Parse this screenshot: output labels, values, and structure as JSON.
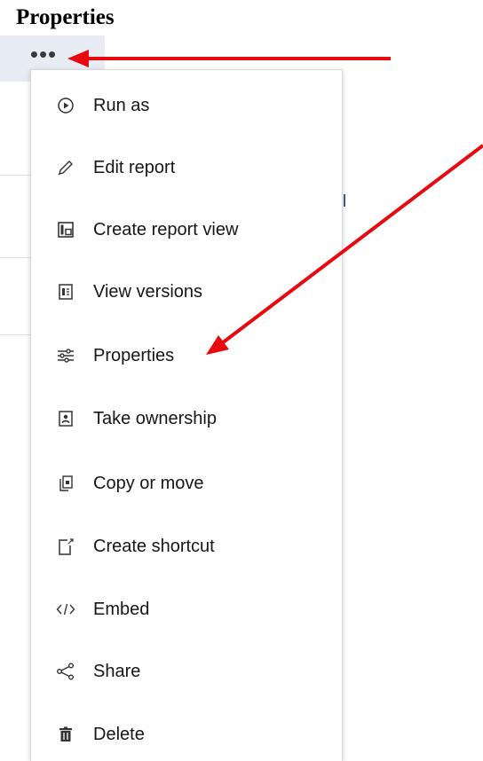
{
  "page": {
    "title": "Properties"
  },
  "overflow_button": {
    "label": "•••"
  },
  "menu": {
    "items": [
      {
        "label": "Run as",
        "icon": "run-icon"
      },
      {
        "label": "Edit report",
        "icon": "pencil-icon"
      },
      {
        "label": "Create report view",
        "icon": "report-view-icon"
      },
      {
        "label": "View versions",
        "icon": "versions-icon"
      },
      {
        "label": "Properties",
        "icon": "sliders-icon"
      },
      {
        "label": "Take ownership",
        "icon": "user-badge-icon"
      },
      {
        "label": "Copy or move",
        "icon": "copy-icon"
      },
      {
        "label": "Create shortcut",
        "icon": "shortcut-icon"
      },
      {
        "label": "Embed",
        "icon": "code-icon"
      },
      {
        "label": "Share",
        "icon": "share-icon"
      },
      {
        "label": "Delete",
        "icon": "trash-icon"
      }
    ]
  },
  "colors": {
    "annotation_arrow": "#e8080f",
    "panel_bg": "#e8ecf3",
    "text": "#161616"
  }
}
